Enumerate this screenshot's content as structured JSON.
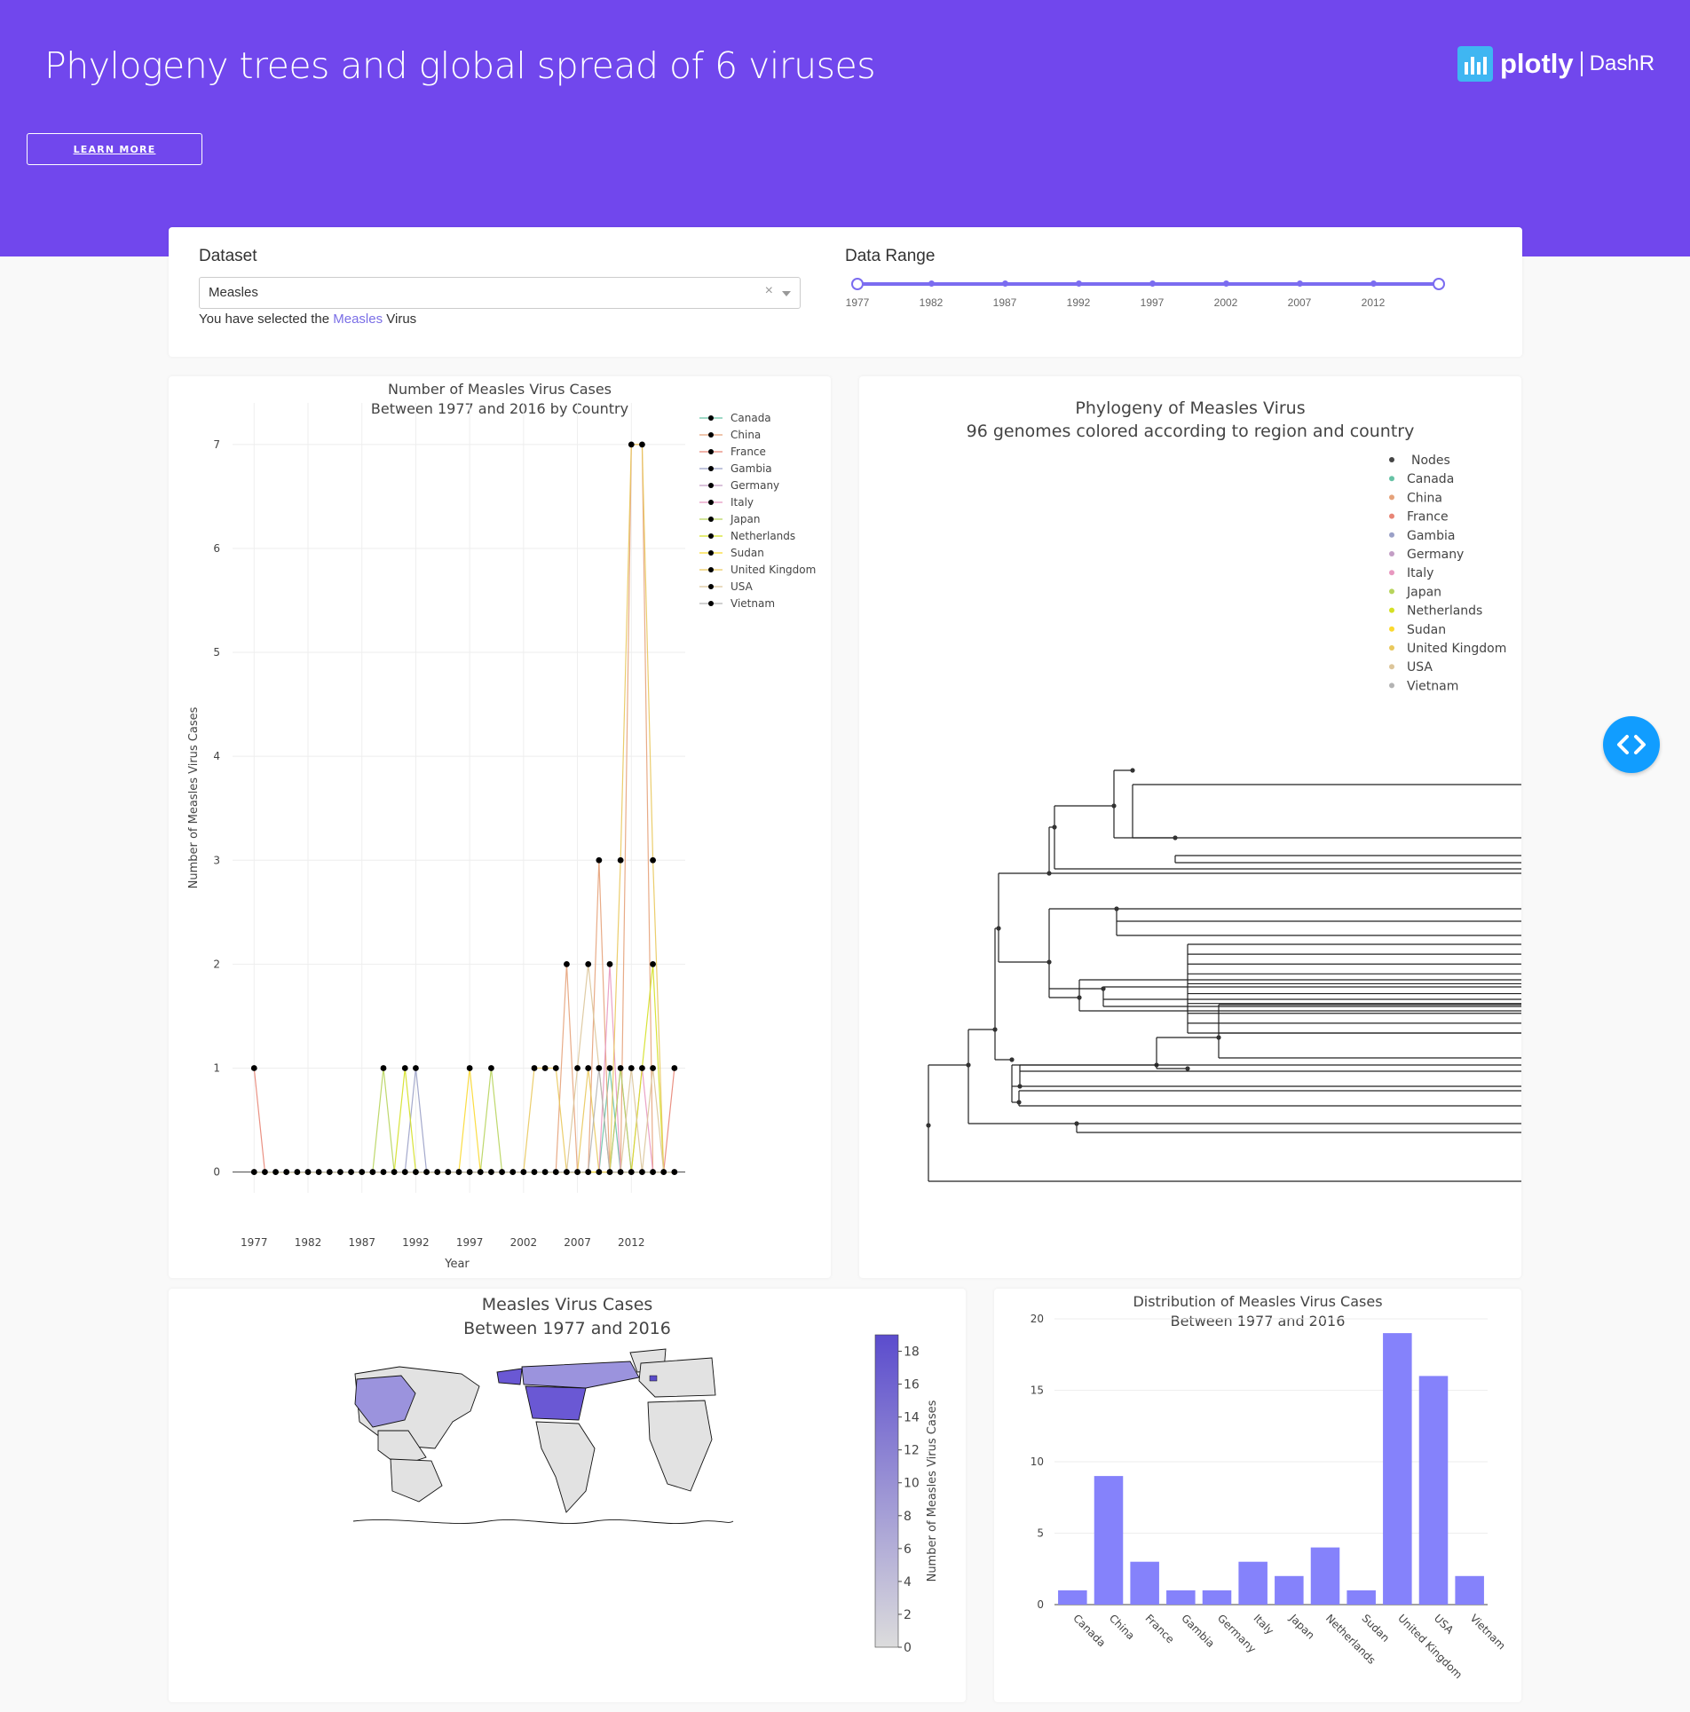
{
  "header": {
    "title": "Phylogeny trees and global spread of 6 viruses",
    "learn_more": "LEARN MORE",
    "logo_word": "plotly",
    "logo_sub": "DashR"
  },
  "controls": {
    "dataset_label": "Dataset",
    "dataset_value": "Measles",
    "clear_glyph": "×",
    "selected_prefix": "You have selected the",
    "selected_virus": "Measles",
    "selected_suffix": "Virus",
    "range_label": "Data Range",
    "range_ticks": [
      "1977",
      "1982",
      "1987",
      "1992",
      "1997",
      "2002",
      "2007",
      "2012"
    ]
  },
  "colors": {
    "accent": "#7147ed",
    "slider": "#7b6cf0",
    "bar": "#8582fb",
    "code_button": "#119dff"
  },
  "countries": [
    "Canada",
    "China",
    "France",
    "Gambia",
    "Germany",
    "Italy",
    "Japan",
    "Netherlands",
    "Sudan",
    "United Kingdom",
    "USA",
    "Vietnam"
  ],
  "country_colors": [
    "#66c2a5",
    "#e5a27a",
    "#e88576",
    "#9aa0c7",
    "#c39ec5",
    "#e898c0",
    "#b7d45c",
    "#d4e024",
    "#fbd92f",
    "#e9c85c",
    "#dcc59a",
    "#b3b3b3"
  ],
  "chart_data": [
    {
      "type": "line",
      "title": "Number of Measles Virus Cases",
      "subtitle": "Between 1977 and 2016 by Country",
      "xlabel": "Year",
      "ylabel": "Number of Measles Virus Cases",
      "x_ticks": [
        1977,
        1982,
        1987,
        1992,
        1997,
        2002,
        2007,
        2012
      ],
      "y_ticks": [
        0,
        1,
        2,
        3,
        4,
        5,
        6,
        7
      ],
      "xlim": [
        1975,
        2017
      ],
      "ylim": [
        -0.2,
        7.4
      ],
      "legend": "top-right",
      "series": [
        {
          "name": "Canada",
          "points": [
            [
              2010,
              1
            ]
          ]
        },
        {
          "name": "China",
          "points": [
            [
              2006,
              2
            ],
            [
              2009,
              3
            ],
            [
              2012,
              7
            ],
            [
              2013,
              7
            ]
          ]
        },
        {
          "name": "France",
          "points": [
            [
              1977,
              1
            ],
            [
              2016,
              1
            ]
          ]
        },
        {
          "name": "Gambia",
          "points": [
            [
              1992,
              1
            ]
          ]
        },
        {
          "name": "Germany",
          "points": [
            [
              2011,
              1
            ]
          ]
        },
        {
          "name": "Italy",
          "points": [
            [
              2010,
              2
            ],
            [
              2013,
              1
            ]
          ]
        },
        {
          "name": "Japan",
          "points": [
            [
              1989,
              1
            ],
            [
              1999,
              1
            ],
            [
              2011,
              1
            ]
          ]
        },
        {
          "name": "Netherlands",
          "points": [
            [
              1991,
              1
            ],
            [
              2013,
              1
            ],
            [
              2014,
              2
            ]
          ]
        },
        {
          "name": "Sudan",
          "points": [
            [
              1997,
              1
            ]
          ]
        },
        {
          "name": "United Kingdom",
          "points": [
            [
              2003,
              1
            ],
            [
              2004,
              1
            ],
            [
              2005,
              1
            ],
            [
              2008,
              1
            ],
            [
              2011,
              3
            ],
            [
              2012,
              7
            ],
            [
              2013,
              7
            ],
            [
              2014,
              3
            ]
          ]
        },
        {
          "name": "USA",
          "points": [
            [
              2007,
              1
            ],
            [
              2008,
              2
            ],
            [
              2009,
              1
            ],
            [
              2012,
              1
            ],
            [
              2014,
              1
            ]
          ]
        },
        {
          "name": "Vietnam",
          "points": [
            [
              2009,
              1
            ]
          ]
        }
      ]
    },
    {
      "type": "tree",
      "title": "Phylogeny of Measles Virus",
      "subtitle": "96 genomes colored according to region and country",
      "legend_items": [
        "Nodes",
        "Canada",
        "China",
        "France",
        "Gambia",
        "Germany",
        "Italy",
        "Japan",
        "Netherlands",
        "Sudan",
        "United Kingdom",
        "USA",
        "Vietnam"
      ],
      "legend": "top-right"
    },
    {
      "type": "choropleth",
      "title": "Measles Virus Cases",
      "subtitle": "Between 1977 and 2016",
      "colorbar_title": "Number of Measles Virus Cases",
      "colorbar_ticks": [
        0,
        2,
        4,
        6,
        8,
        10,
        12,
        14,
        16,
        18
      ],
      "zlim": [
        0,
        19
      ]
    },
    {
      "type": "bar",
      "title": "Distribution of Measles Virus Cases",
      "subtitle": "Between 1977 and 2016",
      "categories": [
        "Canada",
        "China",
        "France",
        "Gambia",
        "Germany",
        "Italy",
        "Japan",
        "Netherlands",
        "Sudan",
        "United Kingdom",
        "USA",
        "Vietnam"
      ],
      "values": [
        1,
        9,
        3,
        1,
        1,
        3,
        2,
        4,
        1,
        19,
        16,
        2
      ],
      "y_ticks": [
        0,
        5,
        10,
        15,
        20
      ],
      "ylim": [
        0,
        20
      ]
    }
  ]
}
